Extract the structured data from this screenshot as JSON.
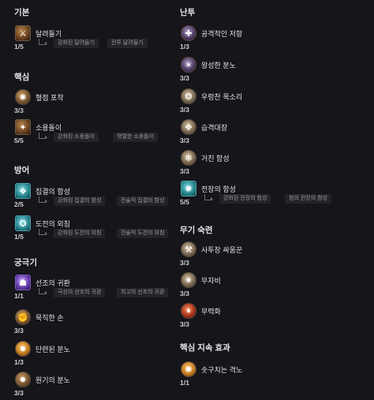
{
  "left": {
    "basic": {
      "title": "기본",
      "skills": [
        {
          "name": "달려들기",
          "rank": "1/5",
          "icon": "charge-icon",
          "upgrades": [
            "강화된 달려들기",
            "전투 달려들기"
          ]
        }
      ]
    },
    "core": {
      "title": "핵심",
      "skills": [
        {
          "name": "혈점 포착",
          "rank": "3/3",
          "icon": "blood-point-icon",
          "upgrades": []
        },
        {
          "name": "소용돌이",
          "rank": "5/5",
          "icon": "whirlwind-icon",
          "upgrades": [
            "강화된 소용돌이",
            "맹렬한 소용돌이"
          ]
        }
      ]
    },
    "defense": {
      "title": "방어",
      "skills": [
        {
          "name": "집결의 함성",
          "rank": "2/5",
          "icon": "rallying-cry-icon",
          "upgrades": [
            "강화된 집결의 함성",
            "전술적 집결의 함성"
          ]
        },
        {
          "name": "도전의 외침",
          "rank": "1/5",
          "icon": "challenging-shout-icon",
          "upgrades": [
            "강화된 도전의 외침",
            "전술적 도전의 외침"
          ]
        }
      ]
    },
    "ultimate": {
      "title": "궁극기",
      "skills": [
        {
          "name": "선조의 귀환",
          "rank": "1/1",
          "icon": "call-of-ancients-icon",
          "upgrades": [
            "극상의 선조의 귀환",
            "최고의 선조의 귀환"
          ]
        },
        {
          "name": "묵직한 손",
          "rank": "3/3",
          "icon": "heavy-handed-icon",
          "upgrades": []
        },
        {
          "name": "단련된 분노",
          "rank": "1/3",
          "icon": "tempered-fury-icon",
          "upgrades": []
        },
        {
          "name": "원기의 분노",
          "rank": "3/3",
          "icon": "invigorating-fury-icon",
          "upgrades": []
        }
      ]
    }
  },
  "right": {
    "brawling": {
      "title": "난투",
      "skills": [
        {
          "name": "공격적인 저항",
          "rank": "1/3",
          "icon": "aggressive-resistance-icon",
          "upgrades": []
        },
        {
          "name": "왕성한 분노",
          "rank": "3/3",
          "icon": "prolific-fury-icon",
          "upgrades": []
        },
        {
          "name": "우렁찬 목소리",
          "rank": "3/3",
          "icon": "booming-voice-icon",
          "upgrades": []
        },
        {
          "name": "습격대장",
          "rank": "3/3",
          "icon": "raid-leader-icon",
          "upgrades": []
        },
        {
          "name": "거친 함성",
          "rank": "3/3",
          "icon": "guttural-yell-icon",
          "upgrades": []
        },
        {
          "name": "전장의 함성",
          "rank": "5/5",
          "icon": "war-cry-icon",
          "upgrades": [
            "강화된 전장의 함성",
            "힘의 전장의 함성"
          ]
        }
      ]
    },
    "weapon_mastery": {
      "title": "무기 숙련",
      "skills": [
        {
          "name": "사투장 싸움꾼",
          "rank": "3/3",
          "icon": "pit-fighter-icon",
          "upgrades": []
        },
        {
          "name": "무자비",
          "rank": "3/3",
          "icon": "no-mercy-icon",
          "upgrades": []
        },
        {
          "name": "무력화",
          "rank": "3/3",
          "icon": "slaying-strike-icon",
          "upgrades": []
        }
      ]
    },
    "key_passive": {
      "title": "핵심 지속 효과",
      "skills": [
        {
          "name": "솟구치는 격노",
          "rank": "1/1",
          "icon": "gushing-wounds-icon",
          "upgrades": []
        }
      ]
    }
  }
}
